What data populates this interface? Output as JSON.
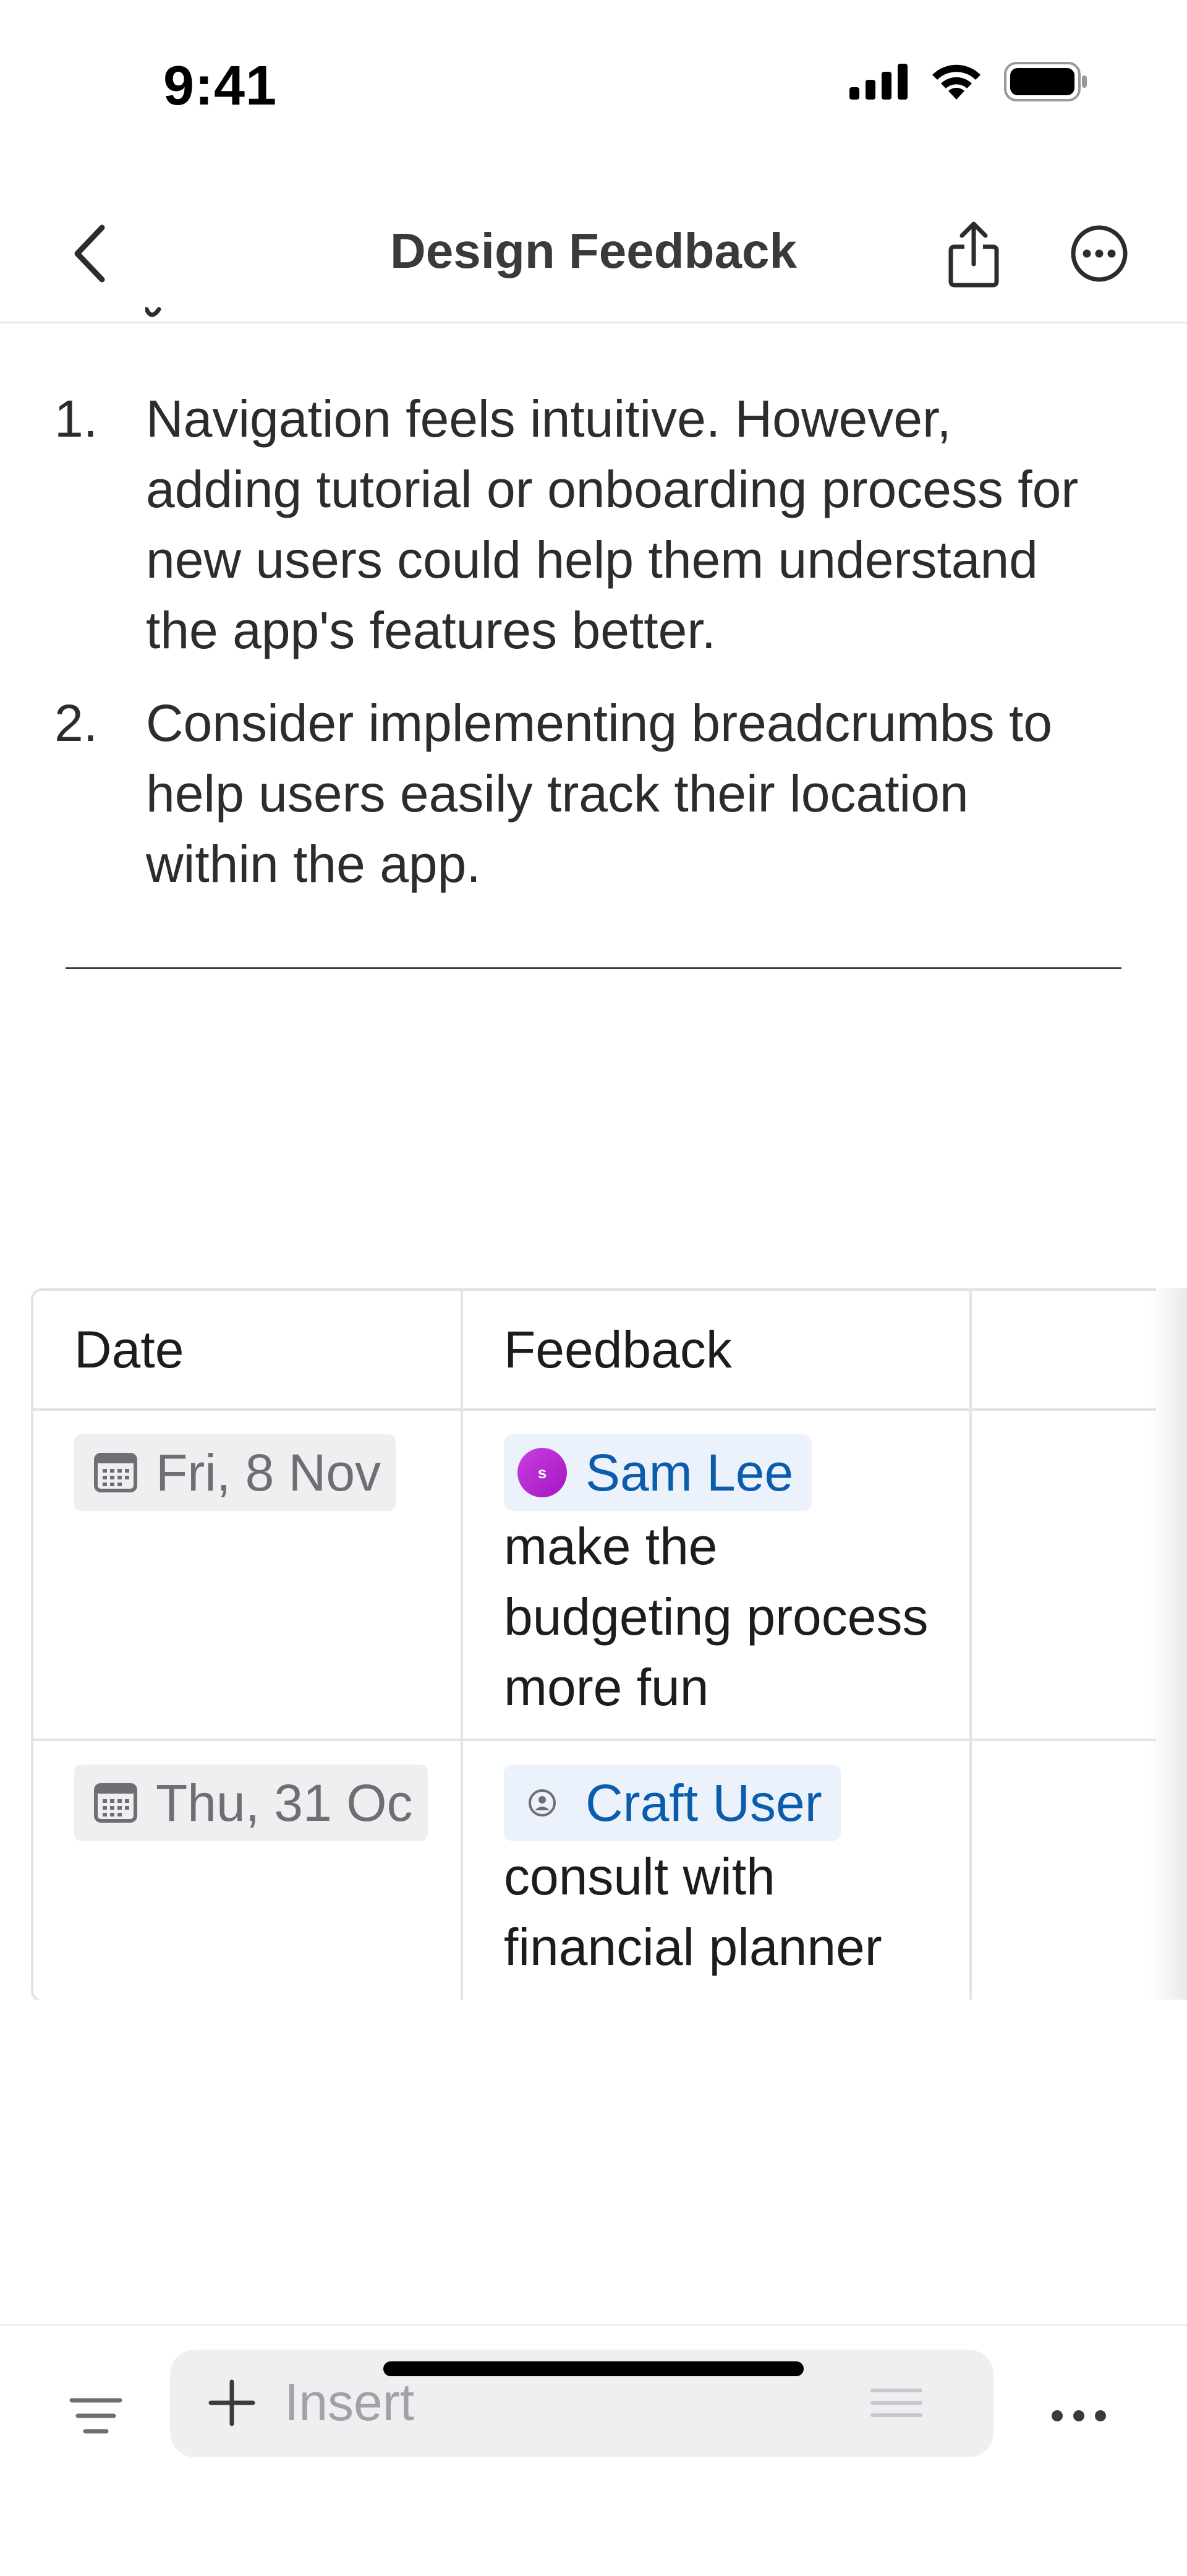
{
  "status_bar": {
    "time": "9:41"
  },
  "nav": {
    "title": "Design Feedback"
  },
  "list": {
    "items": [
      {
        "number": "1.",
        "text": "Navigation feels intuitive. However, adding tutorial or onboarding process for new users could help them understand the app's features better."
      },
      {
        "number": "2.",
        "text": "Consider implementing breadcrumbs to help users easily track their location within the app."
      }
    ]
  },
  "table": {
    "headers": [
      "Date",
      "Feedback",
      ""
    ],
    "rows": [
      {
        "date": "Fri, 8 Nov",
        "mention": "Sam Lee",
        "avatar_initial": "s",
        "feedback": "make the budgeting process more fun"
      },
      {
        "date": "Thu, 31 Oc",
        "mention": "Craft User",
        "feedback": "consult with financial planner"
      }
    ]
  },
  "toolbar": {
    "insert_label": "Insert"
  },
  "colors": {
    "mention_text": "#0b5cad",
    "mention_bg": "#ebf2fb",
    "date_chip_bg": "#efeff1",
    "avatar_purple": "#b92bd2"
  },
  "icons": {
    "nav_back": "chevron-left-icon",
    "nav_share": "share-icon",
    "nav_more": "ellipsis-circle-icon",
    "date": "calendar-icon",
    "toolbar_menu": "text-align-icon",
    "insert_add": "plus-icon",
    "insert_style": "lines-icon",
    "toolbar_more": "ellipsis-icon"
  }
}
